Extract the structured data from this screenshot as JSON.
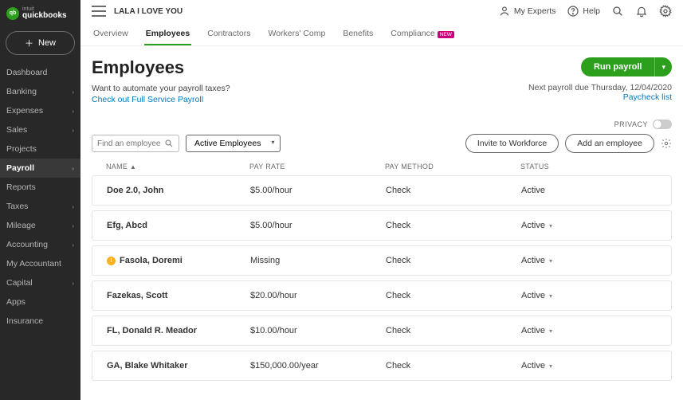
{
  "logo": {
    "top": "intuit",
    "name": "quickbooks"
  },
  "new_button": "New",
  "nav": [
    {
      "label": "Dashboard",
      "expandable": false
    },
    {
      "label": "Banking",
      "expandable": true
    },
    {
      "label": "Expenses",
      "expandable": true
    },
    {
      "label": "Sales",
      "expandable": true
    },
    {
      "label": "Projects",
      "expandable": false
    },
    {
      "label": "Payroll",
      "expandable": true,
      "active": true
    },
    {
      "label": "Reports",
      "expandable": false
    },
    {
      "label": "Taxes",
      "expandable": true
    },
    {
      "label": "Mileage",
      "expandable": true
    },
    {
      "label": "Accounting",
      "expandable": true
    },
    {
      "label": "My Accountant",
      "expandable": false
    },
    {
      "label": "Capital",
      "expandable": true
    },
    {
      "label": "Apps",
      "expandable": false
    },
    {
      "label": "Insurance",
      "expandable": false
    }
  ],
  "company": "LALA I LOVE YOU",
  "top": {
    "experts": "My Experts",
    "help": "Help"
  },
  "tabs": [
    {
      "label": "Overview"
    },
    {
      "label": "Employees",
      "active": true
    },
    {
      "label": "Contractors"
    },
    {
      "label": "Workers' Comp"
    },
    {
      "label": "Benefits"
    },
    {
      "label": "Compliance",
      "badge": "new"
    }
  ],
  "page": {
    "title": "Employees",
    "run_payroll": "Run payroll",
    "promo_q": "Want to automate your payroll taxes?",
    "promo_link": "Check out Full Service Payroll",
    "next_due": "Next payroll due Thursday, 12/04/2020",
    "paycheck_link": "Paycheck list",
    "privacy": "PRIVACY",
    "search_placeholder": "Find an employee",
    "filter": "Active Employees",
    "invite": "Invite to Workforce",
    "add": "Add an employee"
  },
  "columns": {
    "name": "NAME",
    "rate": "PAY RATE",
    "method": "PAY METHOD",
    "status": "STATUS"
  },
  "rows": [
    {
      "name": "Doe 2.0, John",
      "rate": "$5.00/hour",
      "method": "Check",
      "status": "Active",
      "drop": false
    },
    {
      "name": "Efg, Abcd",
      "rate": "$5.00/hour",
      "method": "Check",
      "status": "Active",
      "drop": true
    },
    {
      "name": "Fasola, Doremi",
      "rate": "Missing",
      "method": "Check",
      "status": "Active",
      "drop": true,
      "warn": true
    },
    {
      "name": "Fazekas, Scott",
      "rate": "$20.00/hour",
      "method": "Check",
      "status": "Active",
      "drop": true
    },
    {
      "name": "FL, Donald R. Meador",
      "rate": "$10.00/hour",
      "method": "Check",
      "status": "Active",
      "drop": true
    },
    {
      "name": "GA, Blake Whitaker",
      "rate": "$150,000.00/year",
      "method": "Check",
      "status": "Active",
      "drop": true
    }
  ]
}
